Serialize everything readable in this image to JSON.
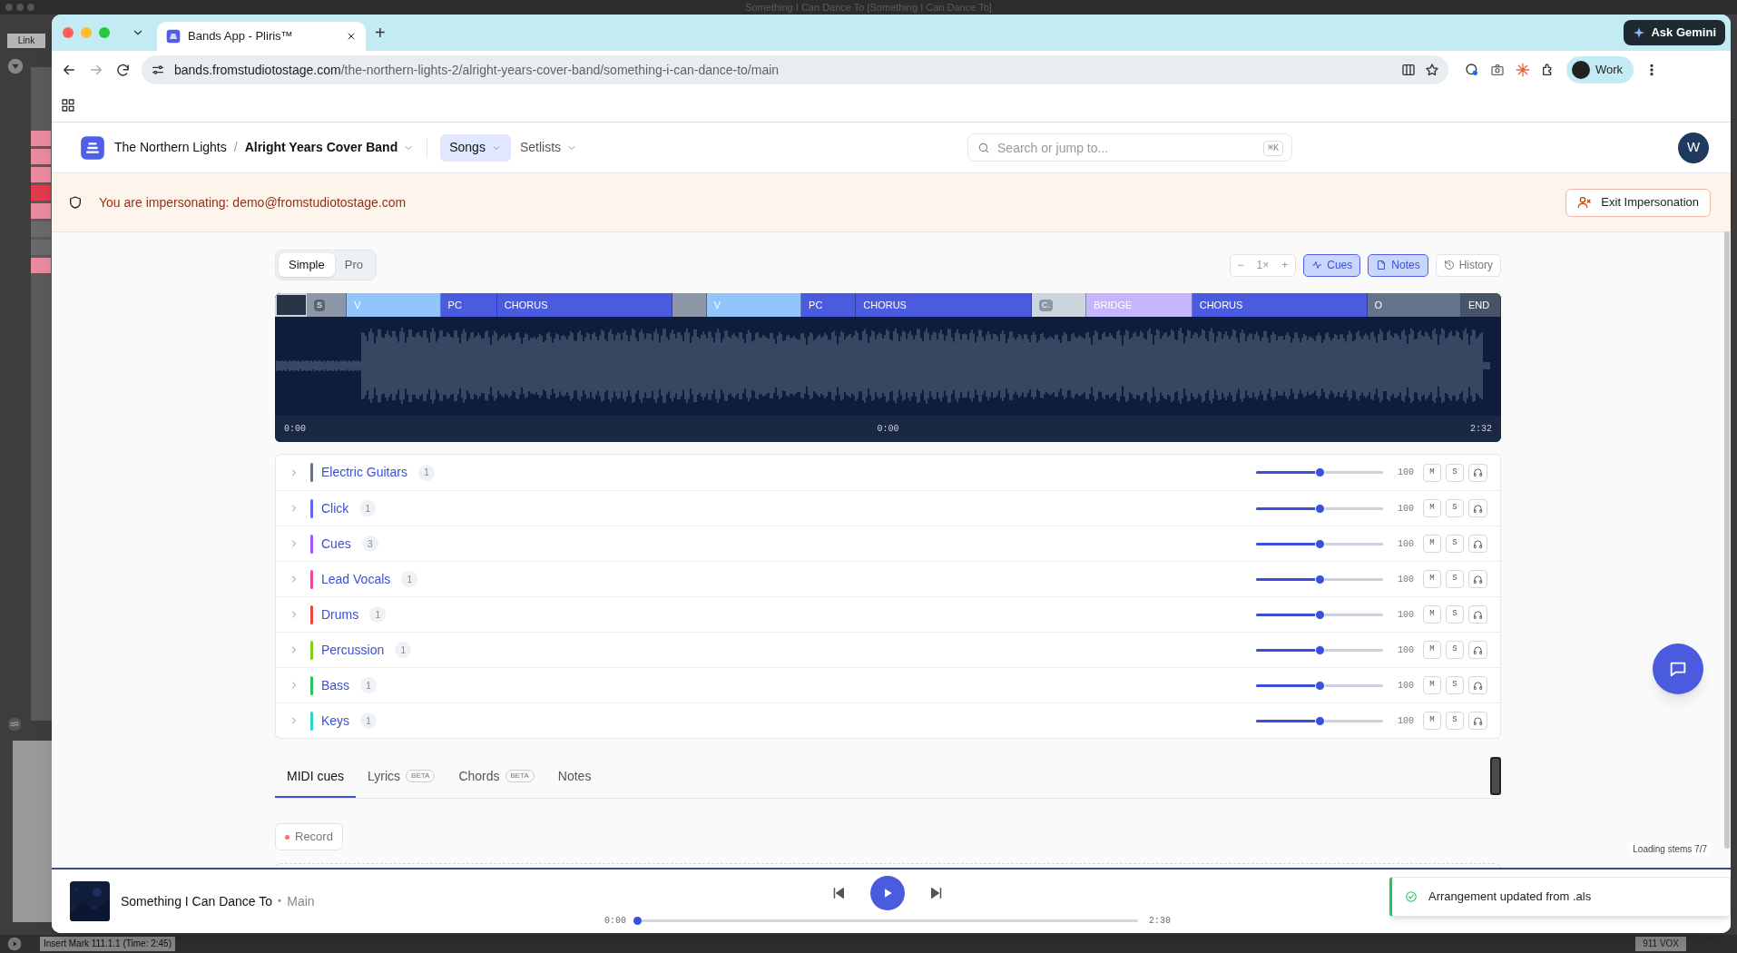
{
  "desktop": {
    "title": "Something I Can Dance To [Something I Can Dance To]",
    "link_button": "Link",
    "status_text": "Insert Mark 111.1.1 (Time: 2:45)",
    "track_label": "911 VOX"
  },
  "browser": {
    "tab_title": "Bands App - Pliris™",
    "new_tab": "+",
    "url_host": "bands.fromstudiotostage.com",
    "url_path": "/the-northern-lights-2/alright-years-cover-band/something-i-can-dance-to/main",
    "gemini": "Ask Gemini",
    "profile": "Work"
  },
  "header": {
    "band": "The Northern Lights",
    "separator": "/",
    "project": "Alright Years Cover Band",
    "nav": [
      {
        "label": "Songs",
        "selected": true
      },
      {
        "label": "Setlists",
        "selected": false
      }
    ],
    "search": {
      "placeholder": "Search or jump to...",
      "shortcut": "⌘K"
    },
    "avatar": "W"
  },
  "banner": {
    "message": "You are impersonating: demo@fromstudiotostage.com",
    "button": "Exit Impersonation"
  },
  "mode_tabs": [
    {
      "label": "Simple",
      "selected": true
    },
    {
      "label": "Pro",
      "selected": false
    }
  ],
  "zoom": {
    "minus": "−",
    "value": "1×",
    "plus": "+"
  },
  "toggles": [
    {
      "label": "Cues",
      "kind": "cues",
      "selected": true
    },
    {
      "label": "Notes",
      "kind": "notes",
      "selected": true
    },
    {
      "label": "History",
      "kind": "history",
      "selected": false
    }
  ],
  "sections": [
    {
      "kind": "marker"
    },
    {
      "kind": "tag",
      "label": "S"
    },
    {
      "kind": "verse",
      "label": "V"
    },
    {
      "kind": "prechorus",
      "label": "PC"
    },
    {
      "kind": "chorus",
      "label": "CHORUS"
    },
    {
      "kind": "gap"
    },
    {
      "kind": "verse",
      "label": "V"
    },
    {
      "kind": "prechorus",
      "label": "PC"
    },
    {
      "kind": "chorus",
      "label": "CHORUS"
    },
    {
      "kind": "tag_light",
      "label": "C."
    },
    {
      "kind": "bridge",
      "label": "BRIDGE"
    },
    {
      "kind": "chorus",
      "label": "CHORUS"
    },
    {
      "kind": "outro",
      "label": "O"
    },
    {
      "kind": "end",
      "label": "END"
    }
  ],
  "times": [
    "0:00",
    "0:00",
    "2:32"
  ],
  "tracks": [
    {
      "name": "Electric Guitars",
      "count": "1",
      "color": "#6b7280",
      "level": 0.5,
      "volume": "100",
      "mute": "M",
      "solo": "S"
    },
    {
      "name": "Click",
      "count": "1",
      "color": "#6366f1",
      "level": 0.5,
      "volume": "100",
      "mute": "M",
      "solo": "S"
    },
    {
      "name": "Cues",
      "count": "3",
      "color": "#a855f7",
      "level": 0.5,
      "volume": "100",
      "mute": "M",
      "solo": "S"
    },
    {
      "name": "Lead Vocals",
      "count": "1",
      "color": "#ec4899",
      "level": 0.5,
      "volume": "100",
      "mute": "M",
      "solo": "S"
    },
    {
      "name": "Drums",
      "count": "1",
      "color": "#ef4444",
      "level": 0.5,
      "volume": "100",
      "mute": "M",
      "solo": "S"
    },
    {
      "name": "Percussion",
      "count": "1",
      "color": "#84cc16",
      "level": 0.5,
      "volume": "100",
      "mute": "M",
      "solo": "S"
    },
    {
      "name": "Bass",
      "count": "1",
      "color": "#22c55e",
      "level": 0.5,
      "volume": "100",
      "mute": "M",
      "solo": "S"
    },
    {
      "name": "Keys",
      "count": "1",
      "color": "#2dd4bf",
      "level": 0.5,
      "volume": "100",
      "mute": "M",
      "solo": "S"
    }
  ],
  "bottom_tabs": [
    {
      "label": "MIDI cues",
      "selected": true
    },
    {
      "label": "Lyrics",
      "badge": "BETA",
      "selected": false
    },
    {
      "label": "Chords",
      "badge": "BETA",
      "selected": false
    },
    {
      "label": "Notes",
      "selected": false
    }
  ],
  "record": "Record",
  "loading": "Loading stems 7/7",
  "player": {
    "title": "Something I Can Dance To",
    "dot": "•",
    "version": "Main",
    "elapsed": "0:00",
    "total": "2:30",
    "level": 0
  },
  "toast": "Arrangement updated from .als"
}
